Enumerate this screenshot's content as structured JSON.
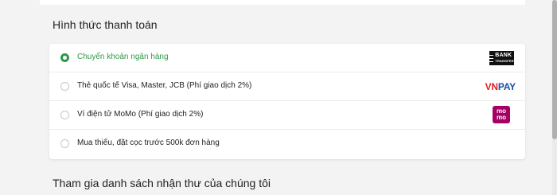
{
  "payment": {
    "title": "Hình thức thanh toán",
    "options": [
      {
        "label": "Chuyển khoản ngân hàng",
        "selected": true,
        "logo": "bank-transfer-logo"
      },
      {
        "label": "Thẻ quốc tế Visa, Master, JCB (Phí giao dịch 2%)",
        "selected": false,
        "logo": "vnpay-logo"
      },
      {
        "label": "Ví điện tử MoMo (Phí giao dịch 2%)",
        "selected": false,
        "logo": "momo-logo"
      },
      {
        "label": "Mua thiếu, đặt cọc trước 500k đơn hàng",
        "selected": false,
        "logo": ""
      }
    ]
  },
  "logos": {
    "bank_word": "BANK",
    "transfer_word": "TRANSFER",
    "vnpay_vn": "VN",
    "vnpay_pay": "PAY",
    "momo_top": "mo",
    "momo_bottom": "mo"
  },
  "newsletter": {
    "title": "Tham gia danh sách nhận thư của chúng tôi"
  },
  "colors": {
    "accent": "#2e9a46",
    "momo": "#a50064",
    "vnpay_red": "#e31e25",
    "vnpay_blue": "#1a4fa3"
  }
}
